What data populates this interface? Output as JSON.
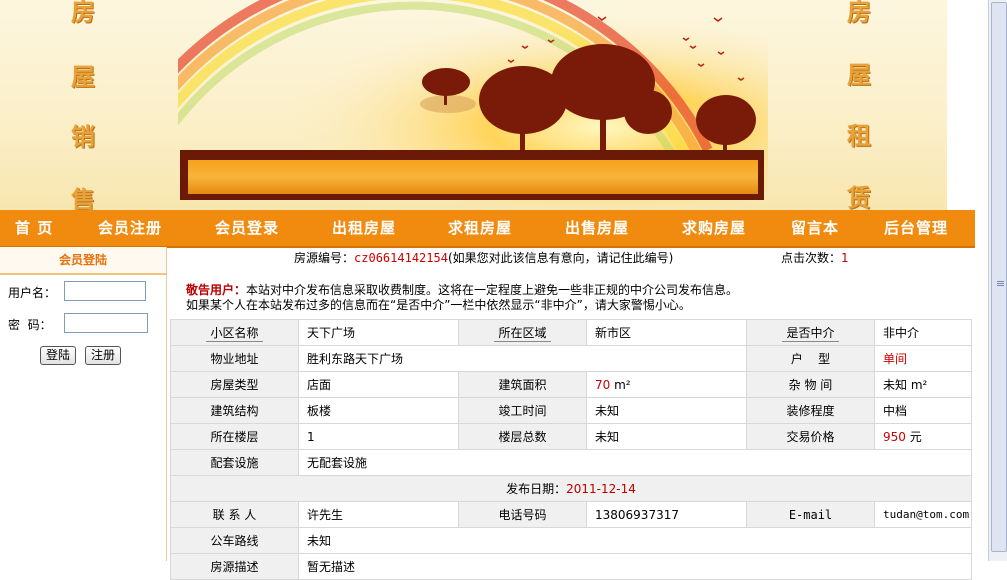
{
  "banner": {
    "left_chars": [
      "房",
      "屋",
      "销",
      "售"
    ],
    "right_chars": [
      "房",
      "屋",
      "租",
      "赁"
    ]
  },
  "nav": {
    "items": [
      "首 页",
      "会员注册",
      "会员登录",
      "出租房屋",
      "求租房屋",
      "出售房屋",
      "求购房屋",
      "留言本",
      "后台管理"
    ]
  },
  "login": {
    "title": "会员登陆",
    "username_label": "用户名：",
    "password_label": "密  码：",
    "login_button": "登陆",
    "register_button": "注册"
  },
  "header": {
    "listing_no_label": "房源编号：",
    "listing_no": "cz06614142154",
    "listing_no_hint": "(如果您对此该信息有意向，请记住此编号)",
    "clicks_label": "点击次数：",
    "clicks": "1"
  },
  "notice": {
    "title": "敬告用户：",
    "line1": "本站对中介发布信息采取收费制度。这将在一定程度上避免一些非正规的中介公司发布信息。",
    "line2": "如果某个人在本站发布过多的信息而在“是否中介”一栏中依然显示“非中介”，请大家警惕小心。"
  },
  "detail": {
    "community_label": "小区名称",
    "community": "天下广场",
    "district_label": "所在区域",
    "district": "新市区",
    "agent_label": "是否中介",
    "agent": "非中介",
    "address_label": "物业地址",
    "address": "胜利东路天下广场",
    "layout_label": "户    型",
    "layout": "单间",
    "type_label": "房屋类型",
    "type": "店面",
    "area_label": "建筑面积",
    "area": "70",
    "area_unit": "m²",
    "misc_label": "杂 物 间",
    "misc": "未知 m²",
    "structure_label": "建筑结构",
    "structure": "板楼",
    "completion_label": "竣工时间",
    "completion": "未知",
    "decoration_label": "装修程度",
    "decoration": "中档",
    "floor_label": "所在楼层",
    "floor": "1",
    "total_floors_label": "楼层总数",
    "total_floors": "未知",
    "price_label": "交易价格",
    "price": "950",
    "price_unit": "元",
    "facilities_label": "配套设施",
    "facilities": "无配套设施",
    "publish_label": "发布日期：",
    "publish_date": "2011-12-14",
    "contact_label": "联 系 人",
    "contact": "许先生",
    "phone_label": "电话号码",
    "phone": "13806937317",
    "email_label": "E-mail",
    "email": "tudan@tom.com",
    "bus_label": "公车路线",
    "bus": "未知",
    "desc_label": "房源描述",
    "desc": "暂无描述"
  }
}
